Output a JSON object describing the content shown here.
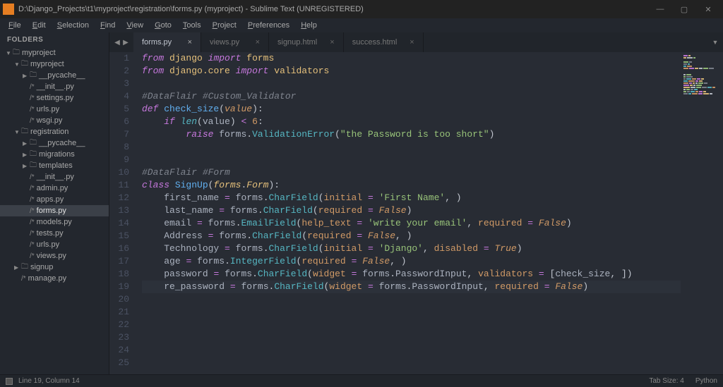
{
  "window": {
    "title_path": "D:\\Django_Projects\\t1\\myproject\\registration\\forms.py (myproject) - Sublime Text (UNREGISTERED)"
  },
  "menu": [
    "File",
    "Edit",
    "Selection",
    "Find",
    "View",
    "Goto",
    "Tools",
    "Project",
    "Preferences",
    "Help"
  ],
  "sidebar": {
    "header": "FOLDERS",
    "tree": [
      {
        "lvl": 0,
        "type": "folder",
        "open": true,
        "name": "myproject"
      },
      {
        "lvl": 1,
        "type": "folder",
        "open": true,
        "name": "myproject"
      },
      {
        "lvl": 2,
        "type": "folder",
        "open": false,
        "name": "__pycache__"
      },
      {
        "lvl": 2,
        "type": "file",
        "name": "__init__.py"
      },
      {
        "lvl": 2,
        "type": "file",
        "name": "settings.py"
      },
      {
        "lvl": 2,
        "type": "file",
        "name": "urls.py"
      },
      {
        "lvl": 2,
        "type": "file",
        "name": "wsgi.py"
      },
      {
        "lvl": 1,
        "type": "folder",
        "open": true,
        "name": "registration"
      },
      {
        "lvl": 2,
        "type": "folder",
        "open": false,
        "name": "__pycache__"
      },
      {
        "lvl": 2,
        "type": "folder",
        "open": false,
        "name": "migrations"
      },
      {
        "lvl": 2,
        "type": "folder",
        "open": false,
        "name": "templates"
      },
      {
        "lvl": 2,
        "type": "file",
        "name": "__init__.py"
      },
      {
        "lvl": 2,
        "type": "file",
        "name": "admin.py"
      },
      {
        "lvl": 2,
        "type": "file",
        "name": "apps.py"
      },
      {
        "lvl": 2,
        "type": "file",
        "name": "forms.py",
        "selected": true
      },
      {
        "lvl": 2,
        "type": "file",
        "name": "models.py"
      },
      {
        "lvl": 2,
        "type": "file",
        "name": "tests.py"
      },
      {
        "lvl": 2,
        "type": "file",
        "name": "urls.py"
      },
      {
        "lvl": 2,
        "type": "file",
        "name": "views.py"
      },
      {
        "lvl": 1,
        "type": "folder",
        "open": false,
        "name": "signup"
      },
      {
        "lvl": 1,
        "type": "file",
        "name": "manage.py"
      }
    ]
  },
  "tabs": [
    {
      "name": "forms.py",
      "active": true
    },
    {
      "name": "views.py",
      "active": false
    },
    {
      "name": "signup.html",
      "active": false
    },
    {
      "name": "success.html",
      "active": false
    }
  ],
  "code": {
    "current_line": 19,
    "total_lines": 25,
    "lines_html": [
      "<span class='k-from'>from</span> <span class='module'>django</span> <span class='k-import'>import</span> <span class='module'>forms</span>",
      "<span class='k-from'>from</span> <span class='module'>django.core</span> <span class='k-import'>import</span> <span class='module'>validators</span>",
      "",
      "<span class='comment'>#DataFlair #Custom_Validator</span>",
      "<span class='k-def'>def</span> <span class='fn-name'>check_size</span><span class='paren'>(</span><span class='param'>value</span><span class='paren'>):</span>",
      "    <span class='k-if'>if</span> <span class='builtin'>len</span><span class='paren'>(</span><span class='attr'>value</span><span class='paren'>)</span> <span class='op'>&lt;</span> <span class='number'>6</span><span class='paren'>:</span>",
      "        <span class='k-raise'>raise</span> <span class='attr'>forms</span><span class='paren'>.</span><span class='fn-call'>ValidationError</span><span class='paren'>(</span><span class='string'>\"the Password is too short\"</span><span class='paren'>)</span>",
      "",
      "",
      "<span class='comment'>#DataFlair #Form</span>",
      "<span class='k-class'>class</span> <span class='fn-name'>SignUp</span><span class='paren'>(</span><span class='inherit'>forms</span><span class='paren'>.</span><span class='inherit'>Form</span><span class='paren'>):</span>",
      "    <span class='attr'>first_name</span> <span class='op'>=</span> <span class='attr'>forms</span><span class='paren'>.</span><span class='fn-call'>CharField</span><span class='paren'>(</span><span class='arg'>initial</span> <span class='op'>=</span> <span class='string'>'First Name'</span><span class='paren'>, )</span>",
      "    <span class='attr'>last_name</span> <span class='op'>=</span> <span class='attr'>forms</span><span class='paren'>.</span><span class='fn-call'>CharField</span><span class='paren'>(</span><span class='arg'>required</span> <span class='op'>=</span> <span class='const'>False</span><span class='paren'>)</span>",
      "    <span class='attr'>email</span> <span class='op'>=</span> <span class='attr'>forms</span><span class='paren'>.</span><span class='fn-call'>EmailField</span><span class='paren'>(</span><span class='arg'>help_text</span> <span class='op'>=</span> <span class='string'>'write your email'</span><span class='paren'>,</span> <span class='arg'>required</span> <span class='op'>=</span> <span class='const'>False</span><span class='paren'>)</span>",
      "    <span class='attr'>Address</span> <span class='op'>=</span> <span class='attr'>forms</span><span class='paren'>.</span><span class='fn-call'>CharField</span><span class='paren'>(</span><span class='arg'>required</span> <span class='op'>=</span> <span class='const'>False</span><span class='paren'>, )</span>",
      "    <span class='attr'>Technology</span> <span class='op'>=</span> <span class='attr'>forms</span><span class='paren'>.</span><span class='fn-call'>CharField</span><span class='paren'>(</span><span class='arg'>initial</span> <span class='op'>=</span> <span class='string'>'Django'</span><span class='paren'>,</span> <span class='arg'>disabled</span> <span class='op'>=</span> <span class='const'>True</span><span class='paren'>)</span>",
      "    <span class='attr'>age</span> <span class='op'>=</span> <span class='attr'>forms</span><span class='paren'>.</span><span class='fn-call'>IntegerField</span><span class='paren'>(</span><span class='arg'>required</span> <span class='op'>=</span> <span class='const'>False</span><span class='paren'>, )</span>",
      "    <span class='attr'>password</span> <span class='op'>=</span> <span class='attr'>forms</span><span class='paren'>.</span><span class='fn-call'>CharField</span><span class='paren'>(</span><span class='arg'>widget</span> <span class='op'>=</span> <span class='attr'>forms</span><span class='paren'>.</span><span class='attr'>PasswordInput</span><span class='paren'>,</span> <span class='arg'>validators</span> <span class='op'>=</span> <span class='paren'>[</span><span class='attr'>check_size</span><span class='paren'>, ])</span>",
      "    <span class='attr'>re_password</span> <span class='op'>=</span> <span class='attr'>forms</span><span class='paren'>.</span><span class='fn-call'>CharField</span><span class='paren'>(</span><span class='arg'>widget</span> <span class='op'>=</span> <span class='attr'>forms</span><span class='paren'>.</span><span class='attr'>PasswordInput</span><span class='paren'>,</span> <span class='arg'>required</span> <span class='op'>=</span> <span class='const'>False</span><span class='paren'>)</span>",
      "",
      "",
      "",
      "",
      "",
      ""
    ]
  },
  "status": {
    "cursor": "Line 19, Column 14",
    "tab_size": "Tab Size: 4",
    "lang": "Python"
  }
}
